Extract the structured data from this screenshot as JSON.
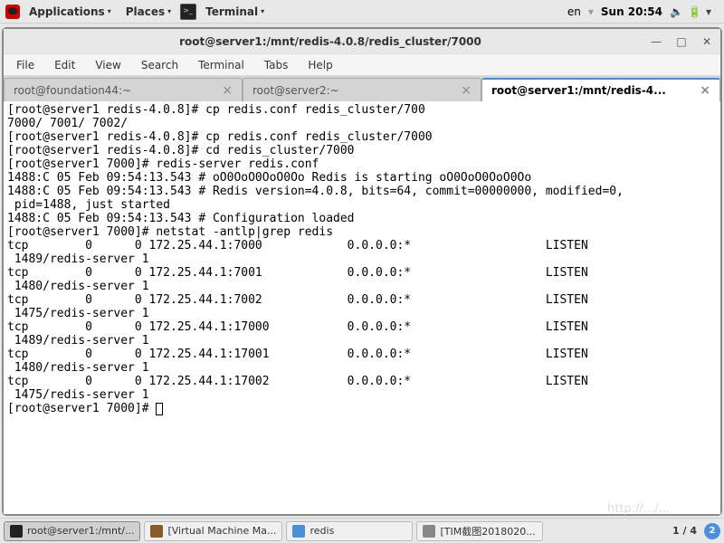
{
  "topbar": {
    "applications": "Applications",
    "places": "Places",
    "terminal": "Terminal",
    "lang": "en",
    "clock": "Sun 20:54"
  },
  "window": {
    "title": "root@server1:/mnt/redis-4.0.8/redis_cluster/7000"
  },
  "menubar": [
    "File",
    "Edit",
    "View",
    "Search",
    "Terminal",
    "Tabs",
    "Help"
  ],
  "tabs": [
    {
      "label": "root@foundation44:~",
      "active": false
    },
    {
      "label": "root@server2:~",
      "active": false
    },
    {
      "label": "root@server1:/mnt/redis-4...",
      "active": true
    }
  ],
  "terminal_lines": [
    "[root@server1 redis-4.0.8]# cp redis.conf redis_cluster/700",
    "7000/ 7001/ 7002/",
    "[root@server1 redis-4.0.8]# cp redis.conf redis_cluster/7000",
    "[root@server1 redis-4.0.8]# cd redis_cluster/7000",
    "[root@server1 7000]# redis-server redis.conf",
    "1488:C 05 Feb 09:54:13.543 # oO0OoO0OoO0Oo Redis is starting oO0OoO0OoO0Oo",
    "1488:C 05 Feb 09:54:13.543 # Redis version=4.0.8, bits=64, commit=00000000, modified=0,",
    " pid=1488, just started",
    "1488:C 05 Feb 09:54:13.543 # Configuration loaded",
    "[root@server1 7000]# netstat -antlp|grep redis",
    "tcp        0      0 172.25.44.1:7000            0.0.0.0:*                   LISTEN",
    " 1489/redis-server 1",
    "tcp        0      0 172.25.44.1:7001            0.0.0.0:*                   LISTEN",
    " 1480/redis-server 1",
    "tcp        0      0 172.25.44.1:7002            0.0.0.0:*                   LISTEN",
    " 1475/redis-server 1",
    "tcp        0      0 172.25.44.1:17000           0.0.0.0:*                   LISTEN",
    " 1489/redis-server 1",
    "tcp        0      0 172.25.44.1:17001           0.0.0.0:*                   LISTEN",
    " 1480/redis-server 1",
    "tcp        0      0 172.25.44.1:17002           0.0.0.0:*                   LISTEN",
    " 1475/redis-server 1"
  ],
  "prompt": "[root@server1 7000]# ",
  "taskbar": {
    "items": [
      {
        "label": "root@server1:/mnt/...",
        "kind": "term",
        "active": true
      },
      {
        "label": "[Virtual Machine Ma...",
        "kind": "vm",
        "active": false
      },
      {
        "label": "redis",
        "kind": "doc",
        "active": false
      },
      {
        "label": "[TIM截图2018020...",
        "kind": "img",
        "active": false
      }
    ],
    "pager": "1 / 4",
    "badge": "2"
  },
  "watermark": "http://.../..."
}
